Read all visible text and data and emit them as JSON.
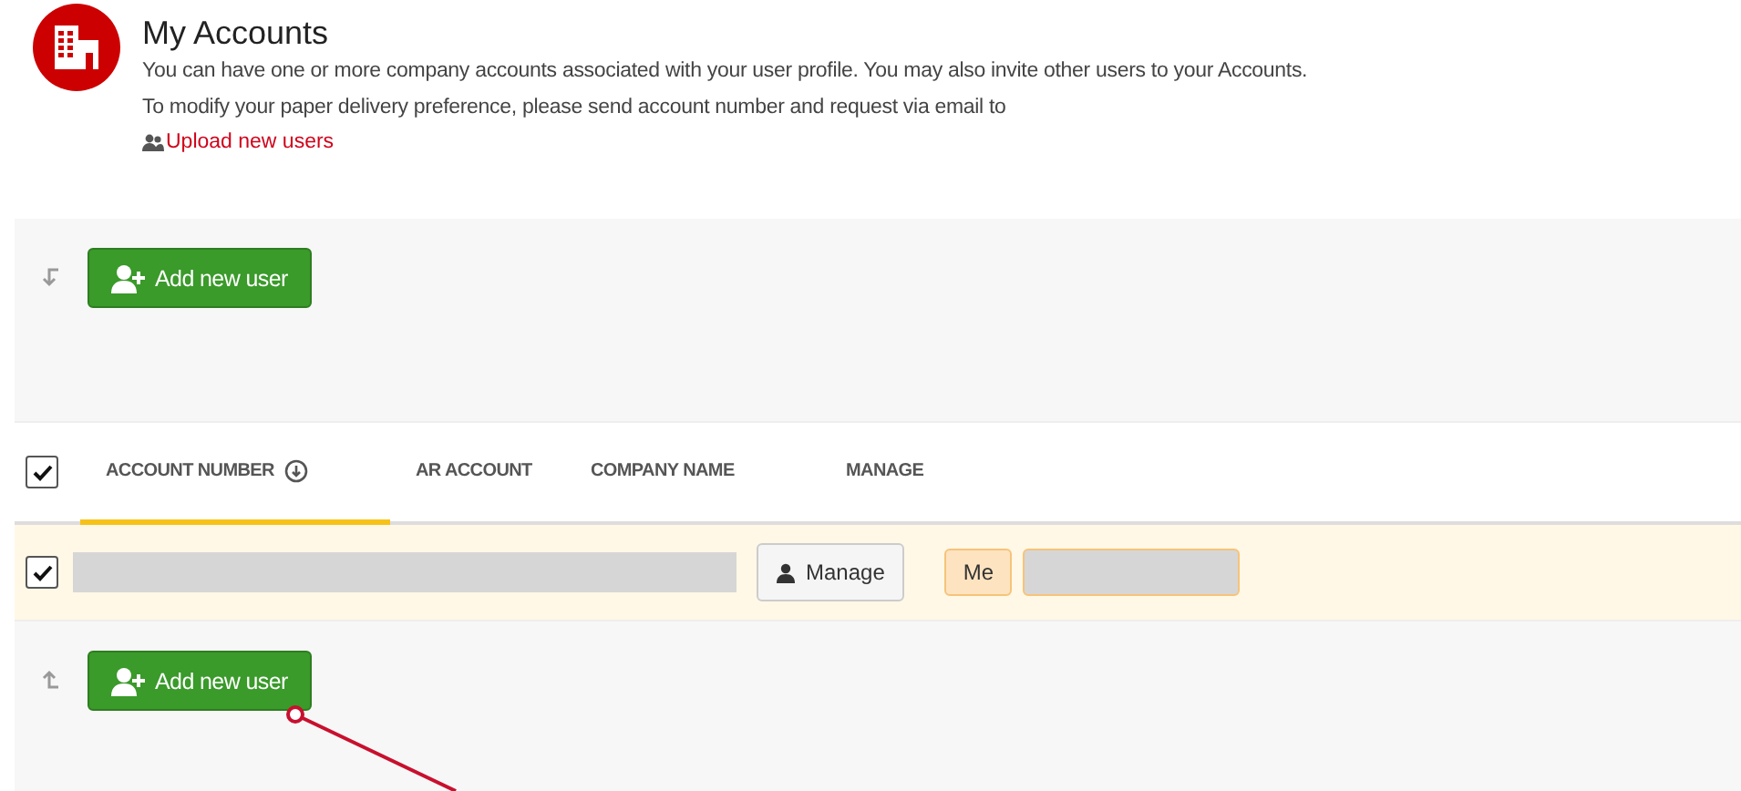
{
  "header": {
    "title": "My Accounts",
    "lines": [
      "You can have one or more company accounts associated with your user profile. You may also invite other users to your Accounts.",
      "To modify your paper delivery preference, please send account number and request via email to"
    ],
    "upload_link": "Upload new users"
  },
  "top_action": {
    "label": "Add new user"
  },
  "table": {
    "select_all": {
      "checked": true
    },
    "columns": [
      {
        "label": "ACCOUNT NUMBER",
        "sorted": true
      },
      {
        "label": "AR ACCOUNT",
        "sorted": false
      },
      {
        "label": "COMPANY NAME",
        "sorted": false
      },
      {
        "label": "MANAGE",
        "sorted": false
      }
    ],
    "rows": [
      {
        "checked": true,
        "selected": true,
        "manage": "Manage",
        "badge": "Me"
      }
    ]
  },
  "bottom_action": {
    "label": "Add new user"
  }
}
